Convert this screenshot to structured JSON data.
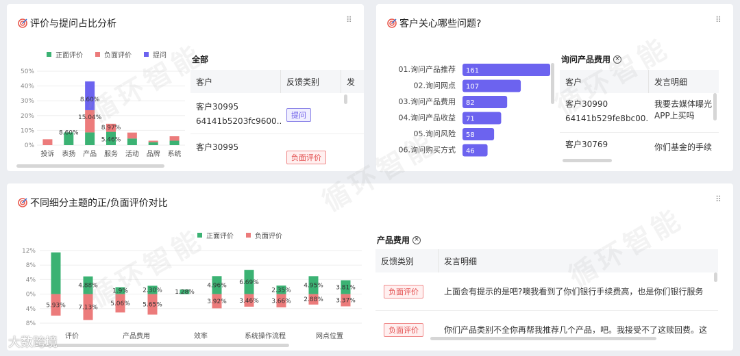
{
  "colors": {
    "positive": "#3bb273",
    "negative": "#ec7b7b",
    "question": "#6c63ef",
    "rank_bar": "#6c63ef"
  },
  "card1": {
    "title": "评价与提问占比分析",
    "legend": [
      "正面评价",
      "负面评价",
      "提问"
    ],
    "table_title": "全部",
    "table": {
      "headers": [
        "客户",
        "反馈类别",
        "发"
      ],
      "rows": [
        {
          "customer": "客户30995",
          "id": "64141b5203fc9600...",
          "tag": "提问",
          "tag_type": "question"
        },
        {
          "customer": "客户30995",
          "id": "",
          "tag": "负面评价",
          "tag_type": "negative"
        }
      ]
    }
  },
  "card2": {
    "title": "客户关心哪些问题?",
    "table_title": "询问产品费用",
    "table": {
      "headers": [
        "客户",
        "发言明细"
      ],
      "rows": [
        {
          "customer": "客户30990",
          "id": "64141b529fe8bc00...",
          "detail": "我要去媒体曝光APP上买吗"
        },
        {
          "customer": "客户30769",
          "id": "",
          "detail": "你们基金的手续"
        }
      ]
    }
  },
  "card3": {
    "title": "不同细分主题的正/负面评价对比",
    "legend": [
      "正面评价",
      "负面评价"
    ],
    "table_title": "产品费用",
    "table": {
      "headers": [
        "反馈类别",
        "发言明细"
      ],
      "rows": [
        {
          "tag": "负面评价",
          "detail": "上面会有提示的是吧?噢我看到了你们银行手续费高，也是你们银行服务"
        },
        {
          "tag": "负面评价",
          "detail": "你们产品类别不全你再帮我推荐几个产品，吧。我接受不了这赎回费。这"
        }
      ]
    }
  },
  "watermark_text": "循环智能",
  "brand_text": "大数跨境",
  "chart_data": [
    {
      "type": "bar",
      "stacked": true,
      "categories": [
        "投诉",
        "表扬",
        "产品",
        "服务",
        "活动",
        "品牌",
        "系统"
      ],
      "series": [
        {
          "name": "正面评价",
          "values": [
            0,
            8.6,
            8.6,
            8.97,
            4.5,
            2.0,
            3.0
          ]
        },
        {
          "name": "负面评价",
          "values": [
            4.0,
            0,
            15.04,
            5.46,
            4.0,
            1.0,
            3.0
          ]
        },
        {
          "name": "提问",
          "values": [
            0,
            0,
            19.5,
            0,
            0,
            0,
            0
          ]
        }
      ],
      "data_labels": [
        "8.60%",
        "8.60%",
        "15.04%",
        "8.97%",
        "5.46%"
      ],
      "ylim": [
        0,
        50
      ],
      "yticks": [
        "50%",
        "40%",
        "30%",
        "20%",
        "10%",
        "0%"
      ],
      "legend_position": "top"
    },
    {
      "type": "bar",
      "orientation": "horizontal",
      "categories": [
        "01.询问产品推荐",
        "02.询问网点",
        "03.询问产品费用",
        "04.询问产品收益",
        "05.询问风险",
        "06.询问购买方式"
      ],
      "values": [
        161,
        107,
        82,
        71,
        58,
        46
      ]
    },
    {
      "type": "bar",
      "diverging": true,
      "groups": [
        "评价",
        "",
        "产品费用",
        "",
        "效率",
        "",
        "系统操作流程",
        "",
        "网点位置",
        ""
      ],
      "xticks": [
        "评价",
        "产品费用",
        "效率",
        "系统操作流程",
        "网点位置"
      ],
      "series": [
        {
          "name": "正面评价",
          "values": [
            11.5,
            4.88,
            1.9,
            2.3,
            1.28,
            4.96,
            6.69,
            2.35,
            4.95,
            3.81
          ]
        },
        {
          "name": "负面评价",
          "values": [
            -5.93,
            -7.13,
            -5.06,
            -5.65,
            0,
            -3.92,
            -3.46,
            -3.66,
            -2.88,
            -3.37
          ]
        }
      ],
      "data_labels": [
        "4.88%",
        "7.13%",
        "5.93%",
        "5.06%",
        "1.9%",
        "2.30%",
        "5.65%",
        "1.28%",
        "4.96%",
        "3.92%",
        "6.69%",
        "3.46%",
        "2.35%",
        "3.66%",
        "4.95%",
        "2.88%",
        "3.81%",
        "3.37%"
      ],
      "ylim": [
        -8,
        12
      ],
      "yticks": [
        "12%",
        "8%",
        "4%",
        "0%",
        "4%",
        "8%"
      ],
      "legend_position": "top"
    }
  ]
}
